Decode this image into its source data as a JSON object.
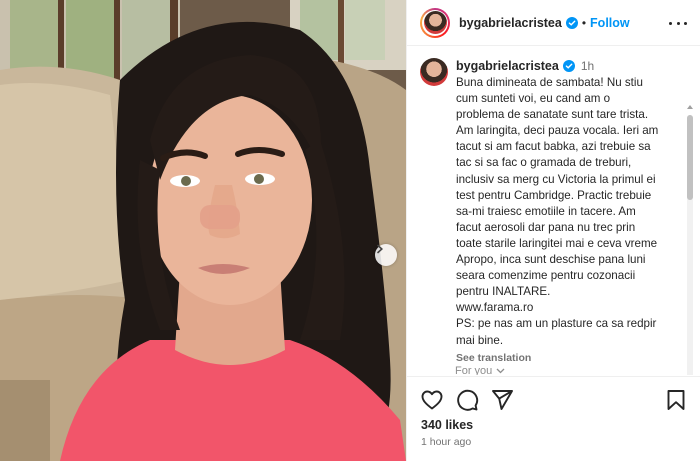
{
  "post": {
    "username": "bygabrielacristea",
    "follow_label": "Follow",
    "separator": "•"
  },
  "caption": {
    "username": "bygabrielacristea",
    "time": "1h",
    "lines": [
      "Buna dimineata de sambata! Nu stiu",
      "cum sunteti voi, eu cand am o",
      "problema de sanatate sunt tare trista.",
      "Am laringita, deci pauza vocala. Ieri am",
      "tacut si am facut babka, azi trebuie sa",
      "tac si sa fac o gramada de treburi,",
      "inclusiv sa merg cu Victoria la primul ei",
      "test pentru Cambridge. Practic trebuie",
      "sa-mi traiesc emotiile in tacere. Am",
      "facut aerosoli dar pana nu trec prin",
      "toate starile laringitei mai e ceva vreme",
      "Apropo, inca sunt deschise pana luni",
      "seara comenzime pentru cozonacii",
      "pentru INALTARE.",
      "www.farama.ro",
      "PS: pe nas am un plasture ca sa redpir",
      "mai bine."
    ],
    "see_translation": "See translation",
    "for_you": "For you"
  },
  "engagement": {
    "likes": "340 likes",
    "posted_ago": "1 hour ago"
  },
  "colors": {
    "accent_blue": "#0095f6",
    "text_dark": "#262626",
    "text_muted": "#737373",
    "divider": "#efefef",
    "shirt_pink": "#f2556a"
  },
  "icons": {
    "verified": "verified-badge-icon",
    "more": "more-options-icon",
    "like": "heart-icon",
    "comment": "comment-icon",
    "share": "paper-plane-icon",
    "save": "bookmark-icon",
    "next": "chevron-right-icon"
  }
}
